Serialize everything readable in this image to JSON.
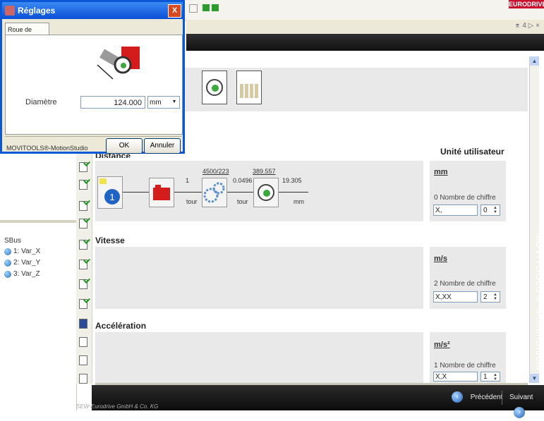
{
  "header": {
    "brand": "EURODRIVE",
    "tab_nav": "⌆ 4 ▷ ×"
  },
  "dialog": {
    "title": "Réglages",
    "close_glyph": "X",
    "tab_label": "Roue de sortie",
    "field_label": "Diamètre",
    "field_value": "124.000",
    "unit_selected": "mm",
    "brand_footer": "MOVITOOLS®-MotionStudio",
    "ok_label": "OK",
    "cancel_label": "Annuler"
  },
  "tree": {
    "root": "SBus",
    "items": [
      "1: Var_X",
      "2: Var_Y",
      "3: Var_Z"
    ]
  },
  "main": {
    "distance_title": "Distance",
    "unit_column_title": "Unité utilisateur",
    "chain": {
      "step1_number": "1",
      "motor_value": "1",
      "motor_unit": "tour",
      "gear_ratio": "4500/223",
      "gear_value": "0.0496",
      "gear_unit": "tour",
      "wheel_ratio": "389.557",
      "wheel_value": "19.305",
      "wheel_unit": "mm"
    },
    "sections": [
      {
        "title": "Distance",
        "unit": "mm",
        "digits_label": "0 Nombre de chiffre",
        "format": "X,",
        "digits": "0"
      },
      {
        "title": "Vitesse",
        "unit": "m/s",
        "digits_label": "2 Nombre de chiffre",
        "format": "X,XX",
        "digits": "2"
      },
      {
        "title": "Accélération",
        "unit": "m/s²",
        "digits_label": "1 Nombre de chiffre",
        "format": "X,X",
        "digits": "1"
      }
    ]
  },
  "footer": {
    "copyright": "SEW-Eurodrive GmbH & Co. KG",
    "prev_label": "Précédent",
    "next_label": "Suivant",
    "watermark": "MOVITOOLS®-MotionStudio"
  },
  "colors": {
    "accent": "#0a58d8",
    "brand_red": "#c8102e",
    "panel_gray": "#e9e9e9"
  }
}
